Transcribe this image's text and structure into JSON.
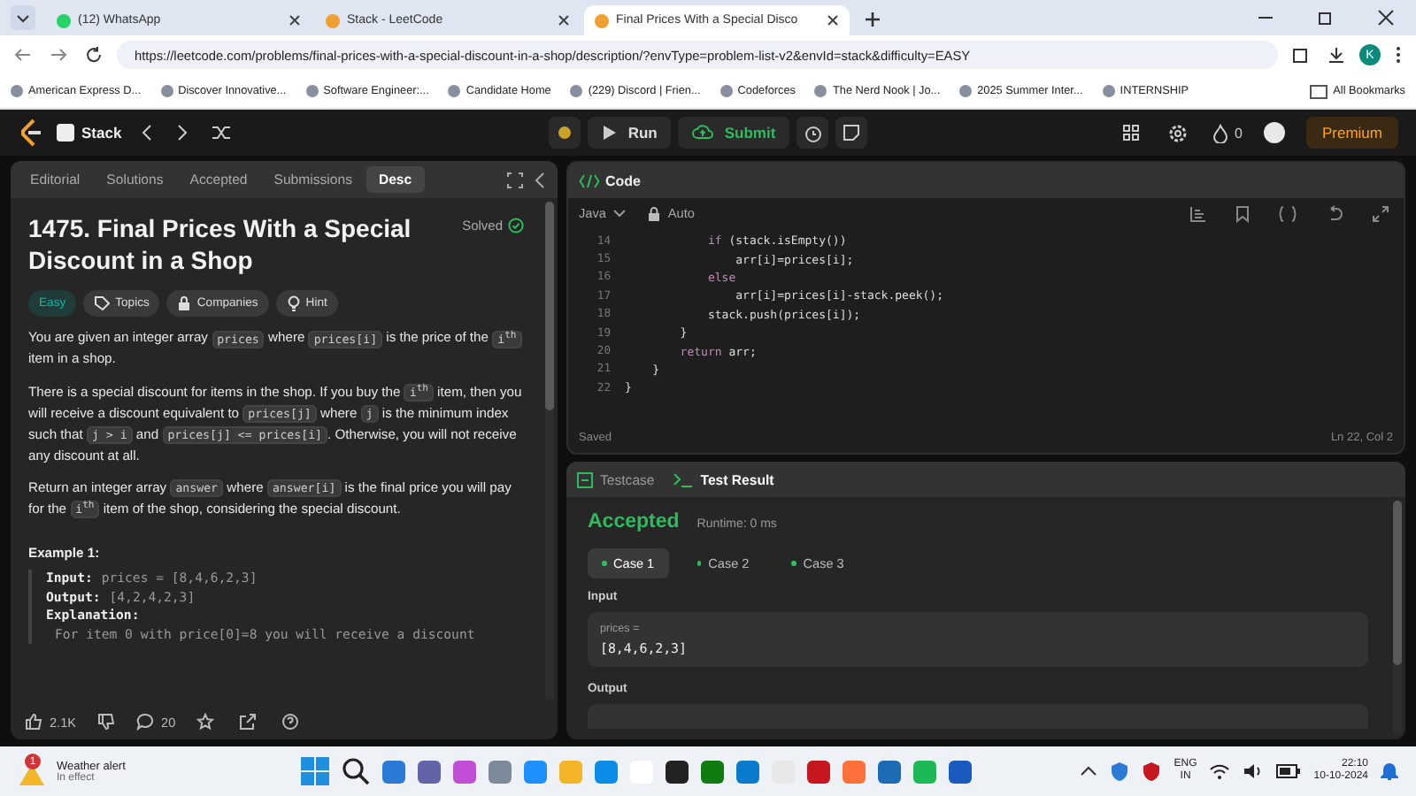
{
  "browser": {
    "tabs": [
      {
        "title": "(12) WhatsApp",
        "selected": false
      },
      {
        "title": "Stack - LeetCode",
        "selected": false
      },
      {
        "title": "Final Prices With a Special Disco",
        "selected": true
      }
    ],
    "url": "https://leetcode.com/problems/final-prices-with-a-special-discount-in-a-shop/description/?envType=problem-list-v2&envId=stack&difficulty=EASY",
    "profile": "K",
    "bookmarks": [
      "American Express D...",
      "Discover Innovative...",
      "Software Engineer:...",
      "Candidate Home",
      "(229) Discord | Frien...",
      "Codeforces",
      "The Nerd Nook | Jo...",
      "2025 Summer Inter...",
      "INTERNSHIP"
    ],
    "all_bookmarks": "All Bookmarks"
  },
  "navbar": {
    "list": "Stack",
    "run": "Run",
    "submit": "Submit",
    "streak": "0",
    "premium": "Premium"
  },
  "problem": {
    "tabs": [
      {
        "label": "Editorial",
        "selected": false
      },
      {
        "label": "Solutions",
        "selected": false
      },
      {
        "label": "Accepted",
        "selected": false
      },
      {
        "label": "Submissions",
        "selected": false
      },
      {
        "label": "Desc",
        "selected": true
      }
    ],
    "title": "1475. Final Prices With a Special Discount in a Shop",
    "status": "Solved",
    "tags": [
      {
        "label": "Easy",
        "kind": "difficulty"
      },
      {
        "label": "Topics",
        "kind": "topics"
      },
      {
        "label": "Companies",
        "kind": "companies"
      },
      {
        "label": "Hint",
        "kind": "hint"
      }
    ],
    "paragraphs": [
      [
        {
          "text": "You are given an integer array ",
          "kind": "text"
        },
        {
          "text": "prices",
          "kind": "code"
        },
        {
          "text": " where ",
          "kind": "text"
        },
        {
          "text": "prices[i]",
          "kind": "code"
        },
        {
          "text": " is the price of the ",
          "kind": "text"
        },
        {
          "text": "i$^{th}$",
          "kind": "code"
        },
        {
          "text": " item in a shop.",
          "kind": "text"
        }
      ],
      [
        {
          "text": "There is a special discount for items in the shop. If you buy the ",
          "kind": "text"
        },
        {
          "text": "i$^{th}$",
          "kind": "code"
        },
        {
          "text": " item, then you will receive a discount equivalent to ",
          "kind": "text"
        },
        {
          "text": "prices[j]",
          "kind": "code"
        },
        {
          "text": " where ",
          "kind": "text"
        },
        {
          "text": "j",
          "kind": "code"
        },
        {
          "text": " is the minimum index such that ",
          "kind": "text"
        },
        {
          "text": "j > i",
          "kind": "code"
        },
        {
          "text": " and ",
          "kind": "text"
        },
        {
          "text": "prices[j] <= prices[i]",
          "kind": "code"
        },
        {
          "text": ". Otherwise, you will not receive any discount at all.",
          "kind": "text"
        }
      ],
      [
        {
          "text": "Return an integer array ",
          "kind": "text"
        },
        {
          "text": "answer",
          "kind": "code"
        },
        {
          "text": " where ",
          "kind": "text"
        },
        {
          "text": "answer[i]",
          "kind": "code"
        },
        {
          "text": " is the final price you will pay for the ",
          "kind": "text"
        },
        {
          "text": "i$^{th}$",
          "kind": "code"
        },
        {
          "text": " item of the shop, considering the special discount.",
          "kind": "text"
        }
      ]
    ],
    "example": {
      "heading": "Example 1:",
      "lines": [
        {
          "label": "Input:",
          "value": "prices = [8,4,6,2,3]"
        },
        {
          "label": "Output:",
          "value": "[4,2,4,2,3]"
        },
        {
          "label": "Explanation:"
        },
        {
          "value": "For item 0 with price[0]=8 you will receive a discount"
        }
      ]
    },
    "likes": "2.1K",
    "comments": "20"
  },
  "editor": {
    "title": "Code",
    "language": "Java",
    "mode": "Auto",
    "lines": [
      {
        "number": "14",
        "segments": [
          {
            "text": "            if",
            "kind": "keyword"
          },
          {
            "text": " (stack.isEmpty())",
            "kind": "plain"
          }
        ]
      },
      {
        "number": "15",
        "segments": [
          {
            "text": "                arr[i]=prices[i];",
            "kind": "plain"
          }
        ]
      },
      {
        "number": "16",
        "segments": [
          {
            "text": "            else",
            "kind": "keyword"
          }
        ]
      },
      {
        "number": "17",
        "segments": [
          {
            "text": "                arr[i]=prices[i]-stack.peek();",
            "kind": "plain"
          }
        ]
      },
      {
        "number": "18",
        "segments": [
          {
            "text": "            stack.push(prices[i]);",
            "kind": "plain"
          }
        ]
      },
      {
        "number": "19",
        "segments": [
          {
            "text": "        }",
            "kind": "plain"
          }
        ]
      },
      {
        "number": "20",
        "segments": [
          {
            "text": "        return",
            "kind": "keyword"
          },
          {
            "text": " arr;",
            "kind": "plain"
          }
        ]
      },
      {
        "number": "21",
        "segments": [
          {
            "text": "    }",
            "kind": "plain"
          }
        ]
      },
      {
        "number": "22",
        "segments": [
          {
            "text": "}",
            "kind": "plain"
          }
        ]
      }
    ],
    "status": "Saved",
    "cursor": "Ln 22, Col 2"
  },
  "result": {
    "tabs": [
      {
        "label": "Testcase",
        "selected": false
      },
      {
        "label": "Test Result",
        "selected": true
      }
    ],
    "verdict": "Accepted",
    "runtime": "Runtime: 0 ms",
    "cases": [
      {
        "label": "Case 1",
        "selected": true
      },
      {
        "label": "Case 2",
        "selected": false
      },
      {
        "label": "Case 3",
        "selected": false
      }
    ],
    "input_label": "Input",
    "param": "prices =",
    "param_value": "[8,4,6,2,3]",
    "output_label": "Output"
  },
  "taskbar": {
    "weather_title": "Weather alert",
    "weather_sub": "In effect",
    "badge": "1",
    "language": "ENG",
    "region": "IN",
    "time": "22:10",
    "date": "10-10-2024"
  }
}
